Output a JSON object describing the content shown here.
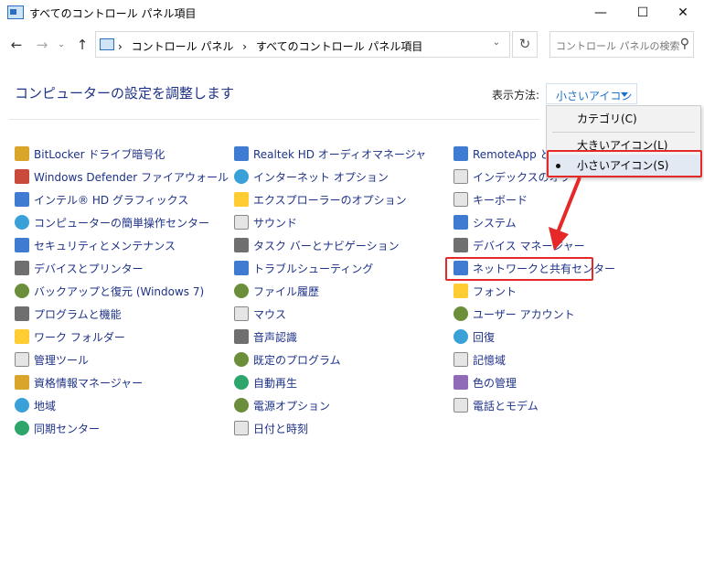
{
  "window": {
    "title": "すべてのコントロール パネル項目",
    "minimize": "—",
    "maximize": "☐",
    "close": "✕"
  },
  "nav": {
    "back": "←",
    "forward": "→",
    "recent": "⌄",
    "up": "↑",
    "breadcrumb": [
      "›",
      "コントロール パネル",
      "›",
      "すべてのコントロール パネル項目"
    ],
    "dropdown": "⌄",
    "refresh": "↻",
    "search_placeholder": "コントロール パネルの検索",
    "search_icon": "⚲"
  },
  "header": {
    "title": "コンピューターの設定を調整します",
    "viewby_label": "表示方法:",
    "viewby_value": "小さいアイコン"
  },
  "menu": {
    "items": [
      "カテゴリ(C)",
      "大きいアイコン(L)",
      "小さいアイコン(S)"
    ],
    "selected_index": 2
  },
  "columns": [
    {
      "items": [
        {
          "label": "BitLocker ドライブ暗号化",
          "icon": "bitlocker-icon"
        },
        {
          "label": "Windows Defender ファイアウォール",
          "icon": "firewall-icon"
        },
        {
          "label": "インテル® HD グラフィックス",
          "icon": "intel-graphics-icon"
        },
        {
          "label": "コンピューターの簡単操作センター",
          "icon": "ease-of-access-icon"
        },
        {
          "label": "セキュリティとメンテナンス",
          "icon": "flag-icon"
        },
        {
          "label": "デバイスとプリンター",
          "icon": "printer-icon"
        },
        {
          "label": "バックアップと復元 (Windows 7)",
          "icon": "backup-icon"
        },
        {
          "label": "プログラムと機能",
          "icon": "programs-icon"
        },
        {
          "label": "ワーク フォルダー",
          "icon": "work-folder-icon"
        },
        {
          "label": "管理ツール",
          "icon": "admin-tools-icon"
        },
        {
          "label": "資格情報マネージャー",
          "icon": "credential-icon"
        },
        {
          "label": "地域",
          "icon": "region-icon"
        },
        {
          "label": "同期センター",
          "icon": "sync-icon"
        }
      ]
    },
    {
      "items": [
        {
          "label": "Realtek HD オーディオマネージャ",
          "icon": "audio-manager-icon"
        },
        {
          "label": "インターネット オプション",
          "icon": "internet-options-icon"
        },
        {
          "label": "エクスプローラーのオプション",
          "icon": "explorer-options-icon"
        },
        {
          "label": "サウンド",
          "icon": "sound-icon"
        },
        {
          "label": "タスク バーとナビゲーション",
          "icon": "taskbar-icon"
        },
        {
          "label": "トラブルシューティング",
          "icon": "troubleshoot-icon"
        },
        {
          "label": "ファイル履歴",
          "icon": "file-history-icon"
        },
        {
          "label": "マウス",
          "icon": "mouse-icon"
        },
        {
          "label": "音声認識",
          "icon": "microphone-icon"
        },
        {
          "label": "既定のプログラム",
          "icon": "default-programs-icon"
        },
        {
          "label": "自動再生",
          "icon": "autoplay-icon"
        },
        {
          "label": "電源オプション",
          "icon": "power-icon"
        },
        {
          "label": "日付と時刻",
          "icon": "clock-icon"
        }
      ]
    },
    {
      "items": [
        {
          "label": "RemoteApp とデ",
          "icon": "remoteapp-icon"
        },
        {
          "label": "インデックスのオプ",
          "icon": "indexing-icon"
        },
        {
          "label": "キーボード",
          "icon": "keyboard-icon"
        },
        {
          "label": "システム",
          "icon": "system-icon"
        },
        {
          "label": "デバイス マネージャー",
          "icon": "device-manager-icon"
        },
        {
          "label": "ネットワークと共有センター",
          "icon": "network-icon"
        },
        {
          "label": "フォント",
          "icon": "font-icon"
        },
        {
          "label": "ユーザー アカウント",
          "icon": "user-accounts-icon"
        },
        {
          "label": "回復",
          "icon": "recovery-icon"
        },
        {
          "label": "記憶域",
          "icon": "storage-icon"
        },
        {
          "label": "色の管理",
          "icon": "color-management-icon"
        },
        {
          "label": "電話とモデム",
          "icon": "phone-modem-icon"
        }
      ]
    }
  ],
  "colors": {
    "link": "#1e3287",
    "accent": "#1e6fc8",
    "highlight": "#e52828"
  }
}
